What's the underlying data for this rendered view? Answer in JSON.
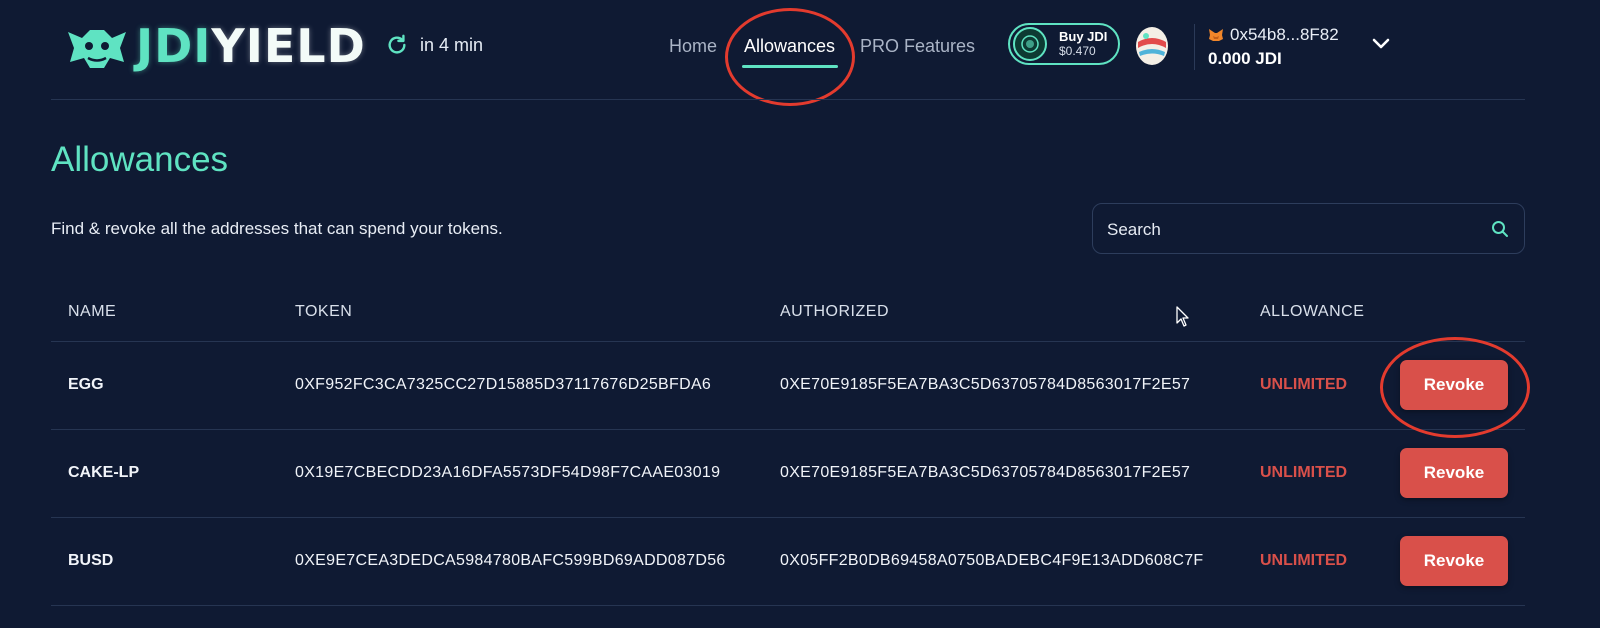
{
  "brand": {
    "name_part1": "JDI",
    "name_part2": "YIELD"
  },
  "refresh": {
    "label": "in 4 min"
  },
  "nav": {
    "items": [
      "Home",
      "Allowances",
      "PRO Features"
    ],
    "active": "Allowances"
  },
  "buy": {
    "label": "Buy JDI",
    "price": "$0.470"
  },
  "wallet": {
    "address": "0x54b8...8F82",
    "balance": "0.000 JDI"
  },
  "page": {
    "title": "Allowances",
    "subtitle": "Find & revoke all the addresses that can spend your tokens."
  },
  "search": {
    "placeholder": "Search"
  },
  "table": {
    "headers": [
      "NAME",
      "TOKEN",
      "AUTHORIZED",
      "ALLOWANCE"
    ],
    "rows": [
      {
        "name": "EGG",
        "token": "0XF952FC3CA7325CC27D15885D37117676D25BFDA6",
        "authorized": "0XE70E9185F5EA7BA3C5D63705784D8563017F2E57",
        "allowance": "UNLIMITED",
        "action": "Revoke"
      },
      {
        "name": "CAKE-LP",
        "token": "0X19E7CBECDD23A16DFA5573DF54D98F7CAAE03019",
        "authorized": "0XE70E9185F5EA7BA3C5D63705784D8563017F2E57",
        "allowance": "UNLIMITED",
        "action": "Revoke"
      },
      {
        "name": "BUSD",
        "token": "0XE9E7CEA3DEDCA5984780BAFC599BD69ADD087D56",
        "authorized": "0X05FF2B0DB69458A0750BADEBC4F9E13ADD608C7F",
        "allowance": "UNLIMITED",
        "action": "Revoke"
      }
    ]
  },
  "colors": {
    "background": "#0f1a33",
    "accent": "#5fe3c2",
    "danger": "#d9504a",
    "annotation": "#e33b2e"
  }
}
